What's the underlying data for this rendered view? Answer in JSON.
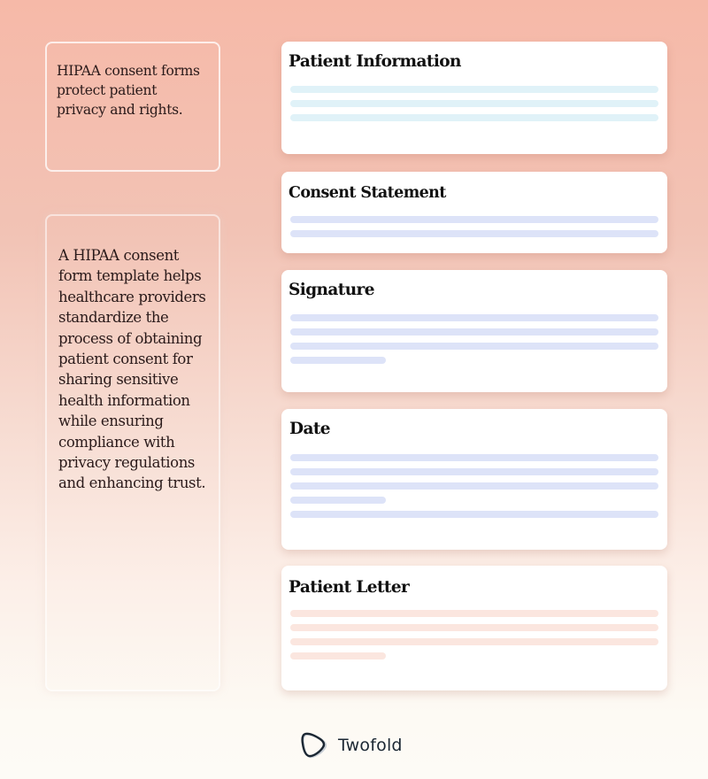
{
  "notes": [
    {
      "text": "HIPAA consent forms protect patient privacy and rights."
    },
    {
      "text": "A HIPAA consent form template helps healthcare providers standardize the process of obtaining patient consent for sharing sensitive health information while ensuring compliance with privacy regulations and enhancing trust."
    }
  ],
  "sections": [
    {
      "title": "Patient Information",
      "bar_color": "#e0f2f8",
      "placeholder_lines": [
        "full",
        "full",
        "full"
      ]
    },
    {
      "title": "Consent Statement",
      "bar_color": "#dde3f8",
      "placeholder_lines": [
        "full",
        "full"
      ]
    },
    {
      "title": "Signature",
      "bar_color": "#dde3f8",
      "placeholder_lines": [
        "full",
        "full",
        "full",
        "short"
      ]
    },
    {
      "title": "Date",
      "bar_color": "#dde3f8",
      "placeholder_lines": [
        "full",
        "full",
        "full",
        "short",
        "full"
      ]
    },
    {
      "title": "Patient Letter",
      "bar_color": "#fbe6df",
      "placeholder_lines": [
        "full",
        "full",
        "full",
        "short"
      ]
    }
  ],
  "brand": {
    "name": "Twofold",
    "icon": "twofold-logo-icon"
  },
  "colors": {
    "background_top": "#f6b9a8",
    "background_bottom": "#fdfbf6",
    "card": "#ffffff"
  }
}
